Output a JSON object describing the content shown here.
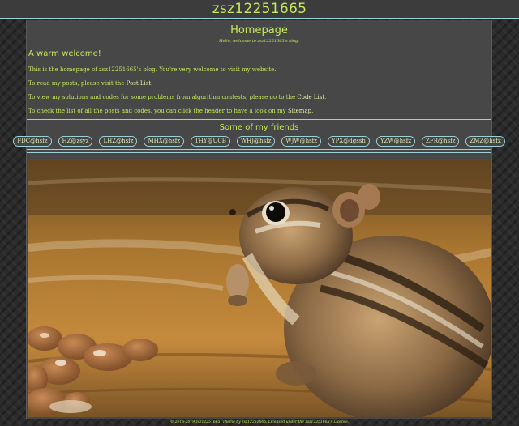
{
  "header": {
    "site_title": "zsz12251665"
  },
  "page": {
    "title": "Homepage",
    "subtitle": "Hello, welcome to zsz12251665's blog."
  },
  "welcome": {
    "heading": "A warm welcome!",
    "p1": "This is the homepage of zsz12251665's blog. You're very welcome to visit my website.",
    "p2_before": "To read my posts, please visit the ",
    "p2_link": "Post List",
    "p2_after": ".",
    "p3_before": "To view my solutions and codes for some problems from algorithm contests, please go to the ",
    "p3_link": "Code List",
    "p3_after": ".",
    "p4_before": "To check the list of all the posts and codes, you can click the header to have a look on my ",
    "p4_link": "Sitemap",
    "p4_after": "."
  },
  "friends": {
    "heading": "Some of my friends",
    "items": [
      "FDC@hsfz",
      "HZ@zsyz",
      "LHZ@hsfz",
      "MHX@hsfz",
      "THY@UCB",
      "WHJ@hsfz",
      "WJW@hsfz",
      "YPX@dgssh",
      "YZW@hsfz",
      "ZFR@hsfz",
      "ZMZ@hsfz"
    ]
  },
  "footer": {
    "text": "© 2016-2019 zsz12251665. Theme by zsz12251665. Licensed under the zsz12251665's License."
  },
  "colors": {
    "accent": "#c6e95a",
    "divider": "#9bd0d8",
    "card": "#474747"
  },
  "icons": {
    "photo": "chipmunk-photo"
  }
}
